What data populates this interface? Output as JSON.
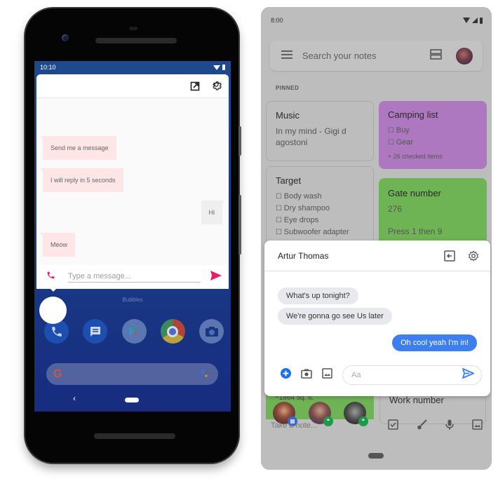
{
  "left_phone": {
    "status": {
      "time": "10:10",
      "wifi_icon": "wifi-icon",
      "battery_icon": "battery-icon"
    },
    "bubble_window": {
      "header_icons": [
        "open-in-new-icon",
        "settings-icon"
      ],
      "messages": [
        {
          "direction": "incoming",
          "text": "Send me a message"
        },
        {
          "direction": "incoming",
          "text": "I will reply in 5 seconds"
        },
        {
          "direction": "outgoing",
          "text": "Hi"
        },
        {
          "direction": "incoming",
          "text": "Meow"
        }
      ],
      "compose": {
        "placeholder": "Type a message...",
        "call_icon": "phone-icon",
        "send_icon": "send-icon"
      }
    },
    "bubbles_label": "Bubbles",
    "dock_apps": [
      "Phone",
      "Messages",
      "Play Store",
      "Chrome",
      "Camera"
    ],
    "search_widget": {
      "logo": "G",
      "assistant_icon": "assistant-icon"
    },
    "nav": {
      "back": "‹"
    }
  },
  "right_phone": {
    "status": {
      "time": "8:00"
    },
    "search": {
      "placeholder": "Search your notes"
    },
    "pinned_label": "PINNED",
    "notes": {
      "music": {
        "title": "Music",
        "body": "In my mind - Gigi d agostoni"
      },
      "camping": {
        "title": "Camping list",
        "items": [
          "Buy",
          "Gear"
        ],
        "extra": "+ 26 checked items",
        "color": "#ae78c0"
      },
      "target": {
        "title": "Target",
        "items": [
          "Body wash",
          "Dry shampoo",
          "Eye drops",
          "Subwoofer adapter"
        ]
      },
      "gate": {
        "title": "Gate number",
        "line1": "276",
        "line2": "Press 1 then 9",
        "color": "#6fb454"
      },
      "partial_green": {
        "text": "~1864 sq. ft."
      },
      "work": {
        "title": "Work number"
      }
    },
    "chat": {
      "contact": "Artur Thomas",
      "messages": [
        {
          "direction": "incoming",
          "text": "What's up tonight?"
        },
        {
          "direction": "incoming",
          "text": "We're gonna go see Us later"
        },
        {
          "direction": "outgoing",
          "text": "Oh cool yeah I'm in!"
        }
      ],
      "compose_placeholder": "Aa",
      "accent": "#3d7ef0"
    },
    "bubble_heads": [
      {
        "badge": "messages"
      },
      {
        "badge": "hangouts"
      },
      {
        "badge": "hangouts"
      }
    ],
    "bottom_bar": {
      "take_note": "Take a note..."
    }
  }
}
